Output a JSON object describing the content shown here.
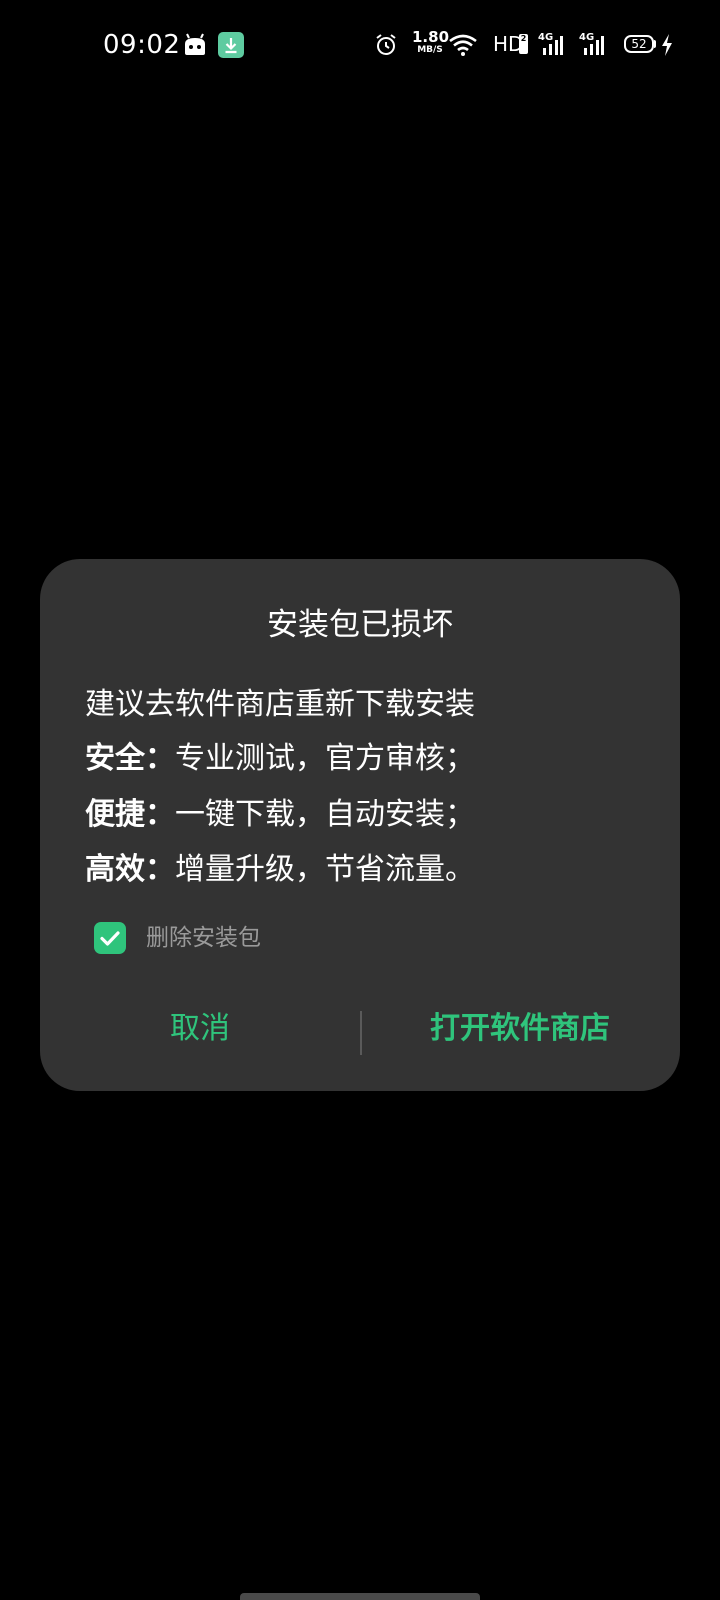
{
  "status_bar": {
    "time": "09:02",
    "icons_left": [
      "robot-icon",
      "download-icon"
    ],
    "network_speed_value": "1.80",
    "network_speed_unit": "MB/S",
    "hd_label": "HD",
    "hd_sub": "2",
    "network_1": "4G",
    "network_2": "4G",
    "battery_level": "52",
    "icons_right": [
      "alarm-icon",
      "wifi-icon",
      "signal-icon",
      "signal-icon",
      "charging-icon"
    ]
  },
  "dialog": {
    "title": "安装包已损坏",
    "message_line1": "建议去软件商店重新下载安装",
    "features": [
      {
        "key": "安全：",
        "text": "专业测试，官方审核；"
      },
      {
        "key": "便捷：",
        "text": "一键下载，自动安装；"
      },
      {
        "key": "高效：",
        "text": "增量升级，节省流量。"
      }
    ],
    "checkbox_label": "删除安装包",
    "checkbox_checked": true,
    "cancel_label": "取消",
    "open_store_label": "打开软件商店"
  },
  "colors": {
    "accent": "#2fc47c",
    "dialog_bg": "#333333",
    "background": "#000000",
    "muted_text": "#9a9a9a"
  }
}
